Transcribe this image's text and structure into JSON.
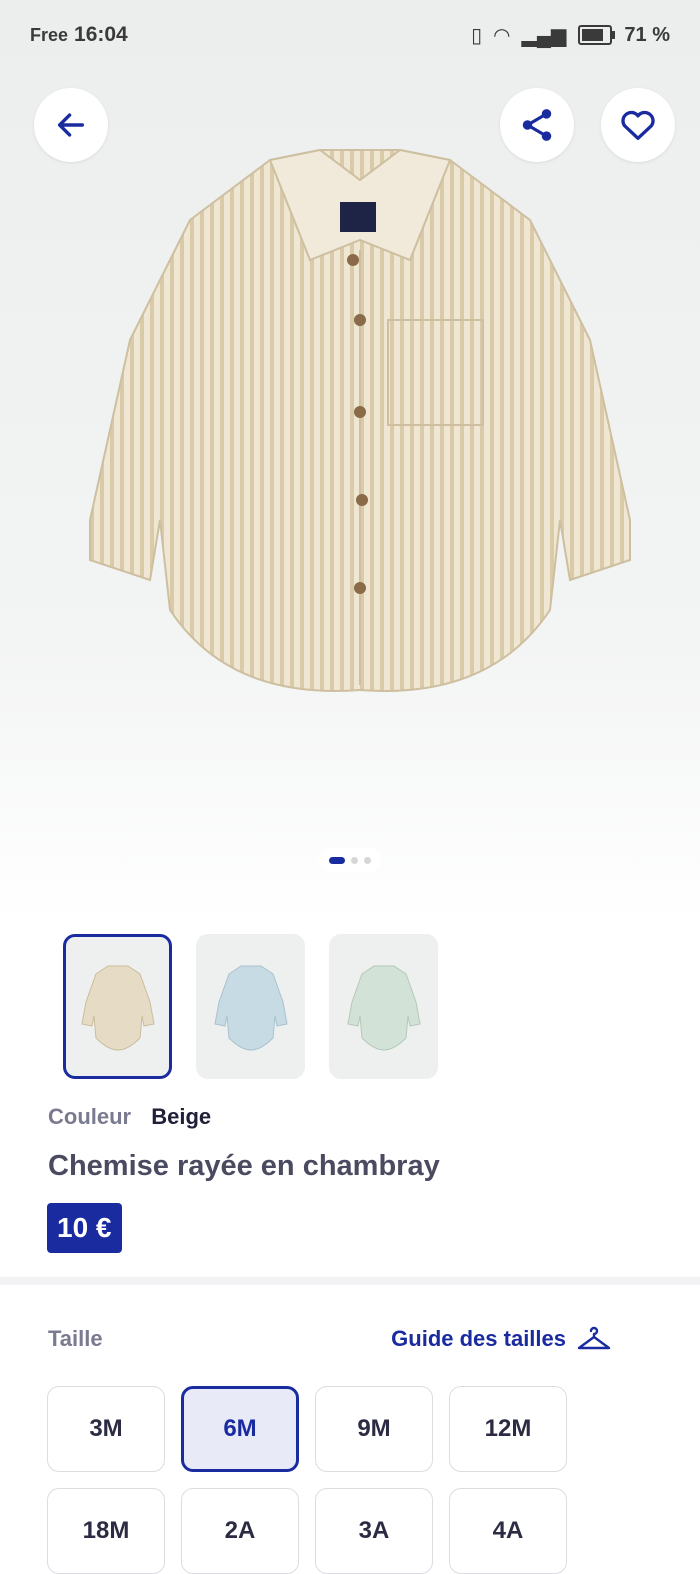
{
  "status_bar": {
    "carrier": "Free",
    "time": "16:04",
    "battery": "71 %"
  },
  "gallery": {
    "image_count": 3,
    "active_index": 0
  },
  "thumbnails": [
    {
      "color": "Beige",
      "swatch": "#e6dcc6",
      "selected": true
    },
    {
      "color": "Bleu",
      "swatch": "#c7dbe4",
      "selected": false
    },
    {
      "color": "Vert",
      "swatch": "#d3e2d6",
      "selected": false
    }
  ],
  "product": {
    "color_label": "Couleur",
    "color_value": "Beige",
    "title": "Chemise rayée en chambray",
    "price": "10 €"
  },
  "size_section": {
    "label": "Taille",
    "guide_label": "Guide des tailles",
    "sizes": [
      {
        "label": "3M",
        "selected": false
      },
      {
        "label": "6M",
        "selected": true
      },
      {
        "label": "9M",
        "selected": false
      },
      {
        "label": "12M",
        "selected": false
      },
      {
        "label": "18M",
        "selected": false
      },
      {
        "label": "2A",
        "selected": false
      },
      {
        "label": "3A",
        "selected": false
      },
      {
        "label": "4A",
        "selected": false
      }
    ]
  },
  "colors": {
    "brand": "#1a2ba0",
    "selected_size_bg": "#e9eaf8"
  }
}
